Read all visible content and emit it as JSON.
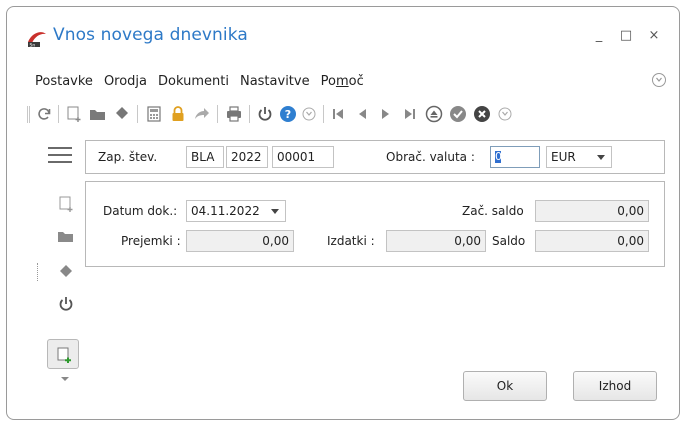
{
  "window": {
    "title": "Vnos novega dnevnika",
    "min_glyph": "_",
    "max_glyph": "□",
    "close_glyph": "×"
  },
  "menu": {
    "items": [
      "Postavke",
      "Orodja",
      "Dokumenti",
      "Nastavitve"
    ],
    "help_prefix": "Po",
    "help_underlined": "m",
    "help_suffix": "oč"
  },
  "toolbar": {
    "icons": [
      "refresh-icon",
      "new-document-icon",
      "open-folder-icon",
      "eraser-icon",
      "calculator-icon",
      "lock-icon",
      "forward-arrow-icon",
      "print-icon",
      "power-icon",
      "help-icon",
      "collapse-icon",
      "first-record-icon",
      "previous-record-icon",
      "next-record-icon",
      "last-record-icon",
      "eject-icon",
      "confirm-icon",
      "cancel-icon",
      "more-icon"
    ]
  },
  "header": {
    "record_label": "Zap. štev.",
    "record_prefix": "BLA",
    "record_year": "2022",
    "record_number": "00001",
    "currency_label": "Obrač. valuta :",
    "currency_code_value": "0",
    "currency_select_value": "EUR"
  },
  "form": {
    "date_label": "Datum dok.:",
    "date_value": "04.11.2022",
    "start_balance_label": "Zač. saldo",
    "start_balance_value": "0,00",
    "receipts_label": "Prejemki :",
    "receipts_value": "0,00",
    "expenses_label": "Izdatki :",
    "expenses_value": "0,00",
    "balance_label": "Saldo",
    "balance_value": "0,00"
  },
  "buttons": {
    "ok_label": "Ok",
    "exit_label": "Izhod"
  },
  "colors": {
    "title": "#2d79c7",
    "accent_blue": "#2f6fd0",
    "lock": "#e0a020",
    "help": "#2f7fd0",
    "new_green": "#2e9a2e"
  }
}
